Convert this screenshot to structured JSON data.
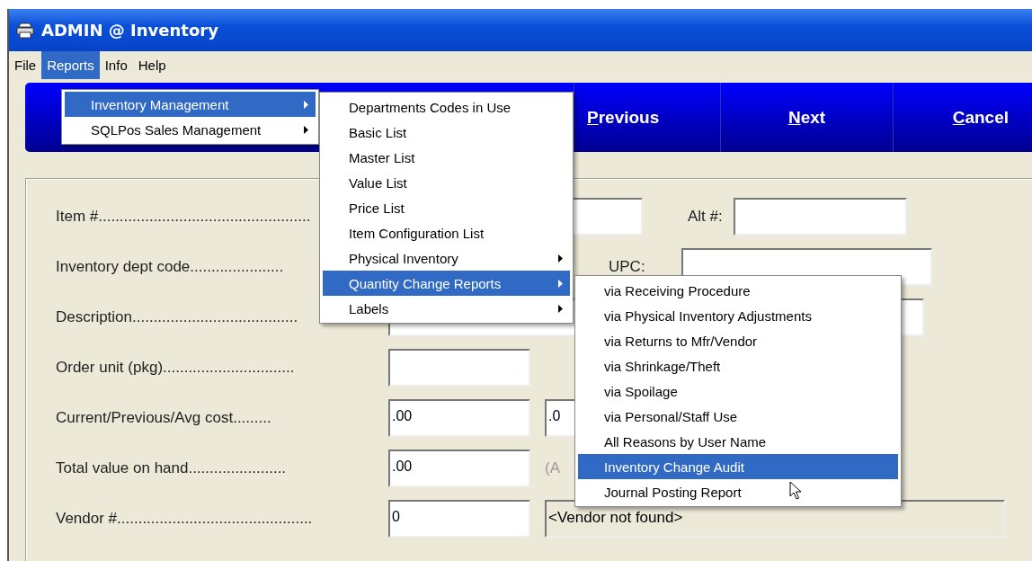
{
  "window": {
    "title": "ADMIN @ Inventory"
  },
  "menu_bar": [
    {
      "label": "File",
      "selected": false
    },
    {
      "label": "Reports",
      "selected": true
    },
    {
      "label": "Info",
      "selected": false
    },
    {
      "label": "Help",
      "selected": false
    }
  ],
  "toolbar": [
    {
      "access_key": "P",
      "label_rest": "revious"
    },
    {
      "access_key": "N",
      "label_rest": "ext"
    },
    {
      "access_key": "C",
      "label_rest": "ancel"
    }
  ],
  "form": [
    {
      "label": "Item #..................................................",
      "fields": [
        {
          "kind": "input"
        },
        {
          "kind": "caption",
          "text": "Alt #:"
        },
        {
          "kind": "input"
        }
      ]
    },
    {
      "label": "Inventory dept code......................",
      "fields": [
        {
          "kind": "caption",
          "text": "UPC:"
        },
        {
          "kind": "input"
        }
      ]
    },
    {
      "label": "Description.......................................",
      "fields": [
        {
          "kind": "input"
        }
      ]
    },
    {
      "label": "Order unit (pkg)...............................",
      "fields": [
        {
          "kind": "input"
        }
      ]
    },
    {
      "label": "Current/Previous/Avg cost.........",
      "fields": [
        {
          "kind": "input",
          "value": ".00"
        },
        {
          "kind": "input",
          "value": ".0"
        }
      ]
    },
    {
      "label": "Total value on hand.......................",
      "fields": [
        {
          "kind": "input",
          "value": ".00"
        },
        {
          "kind": "note",
          "text": "(A"
        }
      ]
    },
    {
      "label": "Vendor #..............................................",
      "fields": [
        {
          "kind": "input",
          "value": "0"
        },
        {
          "kind": "readonly",
          "value": "<Vendor not found>"
        }
      ]
    }
  ],
  "menus": [
    {
      "items": [
        {
          "label": "Inventory Management",
          "submenu": true,
          "selected": true
        },
        {
          "label": "SQLPos Sales Management",
          "submenu": true,
          "selected": false
        }
      ]
    },
    {
      "items": [
        {
          "label": "Departments Codes in Use",
          "submenu": false,
          "selected": false
        },
        {
          "label": "Basic List",
          "submenu": false,
          "selected": false
        },
        {
          "label": "Master List",
          "submenu": false,
          "selected": false
        },
        {
          "label": "Value List",
          "submenu": false,
          "selected": false
        },
        {
          "label": "Price List",
          "submenu": false,
          "selected": false
        },
        {
          "label": "Item Configuration List",
          "submenu": false,
          "selected": false
        },
        {
          "label": "Physical Inventory",
          "submenu": true,
          "selected": false
        },
        {
          "label": "Quantity Change Reports",
          "submenu": true,
          "selected": true
        },
        {
          "label": "Labels",
          "submenu": true,
          "selected": false
        }
      ]
    },
    {
      "items": [
        {
          "label": "via Receiving Procedure",
          "submenu": false,
          "selected": false
        },
        {
          "label": "via Physical Inventory Adjustments",
          "submenu": false,
          "selected": false
        },
        {
          "label": "via Returns to Mfr/Vendor",
          "submenu": false,
          "selected": false
        },
        {
          "label": "via Shrinkage/Theft",
          "submenu": false,
          "selected": false
        },
        {
          "label": "via Spoilage",
          "submenu": false,
          "selected": false
        },
        {
          "label": "via Personal/Staff Use",
          "submenu": false,
          "selected": false
        },
        {
          "label": "All Reasons by User Name",
          "submenu": false,
          "selected": false
        },
        {
          "label": "Inventory Change Audit",
          "submenu": false,
          "selected": true
        },
        {
          "label": "Journal Posting Report",
          "submenu": false,
          "selected": false
        }
      ]
    }
  ]
}
